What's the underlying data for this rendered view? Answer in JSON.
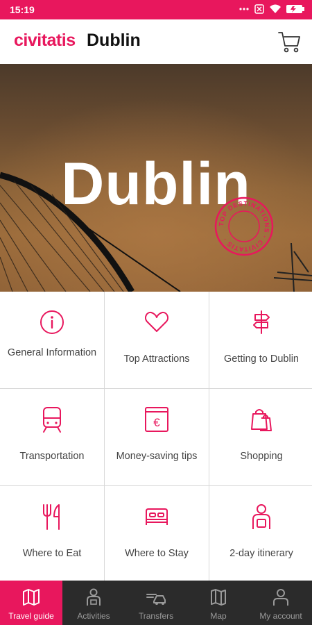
{
  "status_bar": {
    "time": "15:19"
  },
  "header": {
    "brand": "civitatis",
    "city": "Dublin"
  },
  "hero": {
    "title": "Dublin",
    "seal_text": "TOP DESTINATIONS · CIVITATIS ·"
  },
  "colors": {
    "accent": "#e8175d",
    "nav_bg": "#2b2b2b",
    "text": "#444444"
  },
  "tiles": [
    {
      "label": "General Information",
      "icon": "info-icon"
    },
    {
      "label": "Top Attractions",
      "icon": "heart-icon"
    },
    {
      "label": "Getting to Dublin",
      "icon": "signpost-icon"
    },
    {
      "label": "Transportation",
      "icon": "train-icon"
    },
    {
      "label": "Money-saving tips",
      "icon": "euro-icon"
    },
    {
      "label": "Shopping",
      "icon": "shopping-bags-icon"
    },
    {
      "label": "Where to Eat",
      "icon": "cutlery-icon"
    },
    {
      "label": "Where to Stay",
      "icon": "bed-icon"
    },
    {
      "label": "2-day itinerary",
      "icon": "traveler-icon"
    }
  ],
  "bottom_nav": [
    {
      "label": "Travel guide",
      "icon": "map-book-icon",
      "active": true
    },
    {
      "label": "Activities",
      "icon": "guide-person-icon",
      "active": false
    },
    {
      "label": "Transfers",
      "icon": "car-transfer-icon",
      "active": false
    },
    {
      "label": "Map",
      "icon": "map-icon",
      "active": false
    },
    {
      "label": "My account",
      "icon": "user-icon",
      "active": false
    }
  ]
}
